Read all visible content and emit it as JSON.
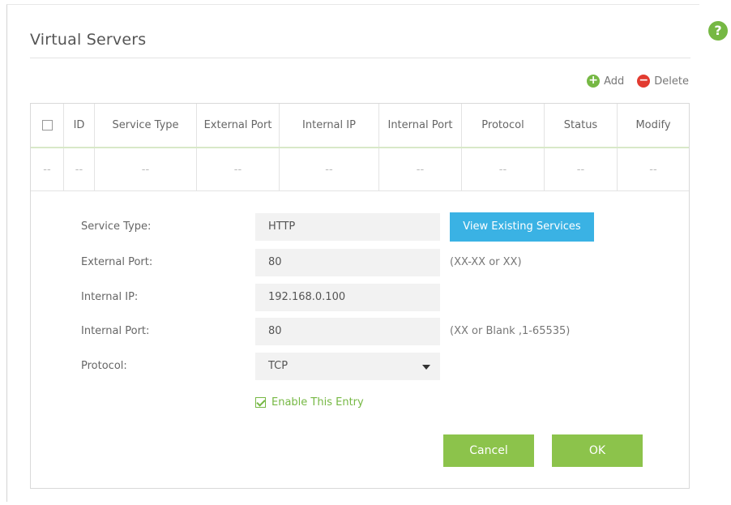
{
  "page": {
    "title": "Virtual Servers",
    "help_label": "?"
  },
  "toolbar": {
    "add_label": "Add",
    "delete_label": "Delete"
  },
  "table": {
    "headers": [
      "ID",
      "Service Type",
      "External Port",
      "Internal IP",
      "Internal Port",
      "Protocol",
      "Status",
      "Modify"
    ],
    "placeholder_row": [
      "--",
      "--",
      "--",
      "--",
      "--",
      "--",
      "--",
      "--",
      "--"
    ]
  },
  "form": {
    "service_type": {
      "label": "Service Type:",
      "value": "HTTP"
    },
    "view_services_label": "View Existing Services",
    "external_port": {
      "label": "External Port:",
      "value": "80",
      "hint": "(XX-XX or XX)"
    },
    "internal_ip": {
      "label": "Internal IP:",
      "value": "192.168.0.100"
    },
    "internal_port": {
      "label": "Internal Port:",
      "value": "80",
      "hint": "(XX or Blank ,1-65535)"
    },
    "protocol": {
      "label": "Protocol:",
      "value": "TCP"
    },
    "enable_label": "Enable This Entry",
    "cancel_label": "Cancel",
    "ok_label": "OK"
  },
  "colors": {
    "accent": "#8cc34b",
    "info": "#3ab2e4",
    "danger": "#e23b30"
  }
}
